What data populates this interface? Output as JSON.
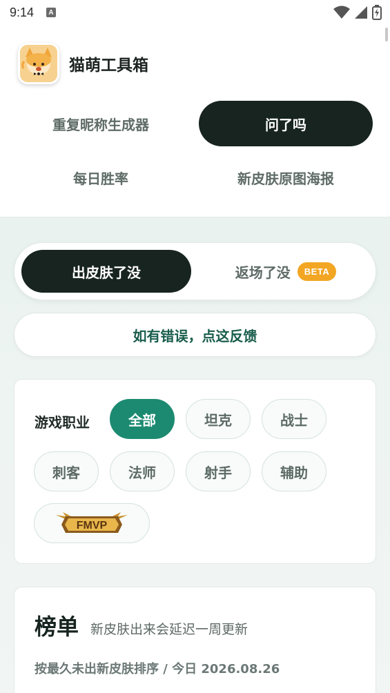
{
  "status_bar": {
    "time": "9:14",
    "notification_icon": "a-icon",
    "icons": [
      "wifi-icon",
      "signal-icon",
      "battery-charging-icon"
    ]
  },
  "header": {
    "app_name": "猫萌工具箱",
    "tools": [
      {
        "label": "重复昵称生成器",
        "active": false
      },
      {
        "label": "问了吗",
        "active": true
      },
      {
        "label": "每日胜率",
        "active": false
      },
      {
        "label": "新皮肤原图海报",
        "active": false
      }
    ]
  },
  "segment": {
    "active_label": "出皮肤了没",
    "inactive_label": "返场了没",
    "badge": "BETA"
  },
  "feedback": {
    "label": "如有错误，点这反馈"
  },
  "filter": {
    "label": "游戏职业",
    "chips": [
      {
        "label": "全部",
        "active": true
      },
      {
        "label": "坦克",
        "active": false
      },
      {
        "label": "战士",
        "active": false
      },
      {
        "label": "刺客",
        "active": false
      },
      {
        "label": "法师",
        "active": false
      },
      {
        "label": "射手",
        "active": false
      },
      {
        "label": "辅助",
        "active": false
      }
    ],
    "fmvp_badge": "FMVP"
  },
  "ranking": {
    "title": "榜单",
    "subtitle": "新皮肤出来会延迟一周更新",
    "note": "按最久未出新皮肤排序 / 今日 2026.08.26"
  },
  "colors": {
    "dark": "#17241f",
    "accent_green": "#1c8a71",
    "beta_orange": "#f2a623",
    "feedback_text": "#185c4b"
  }
}
